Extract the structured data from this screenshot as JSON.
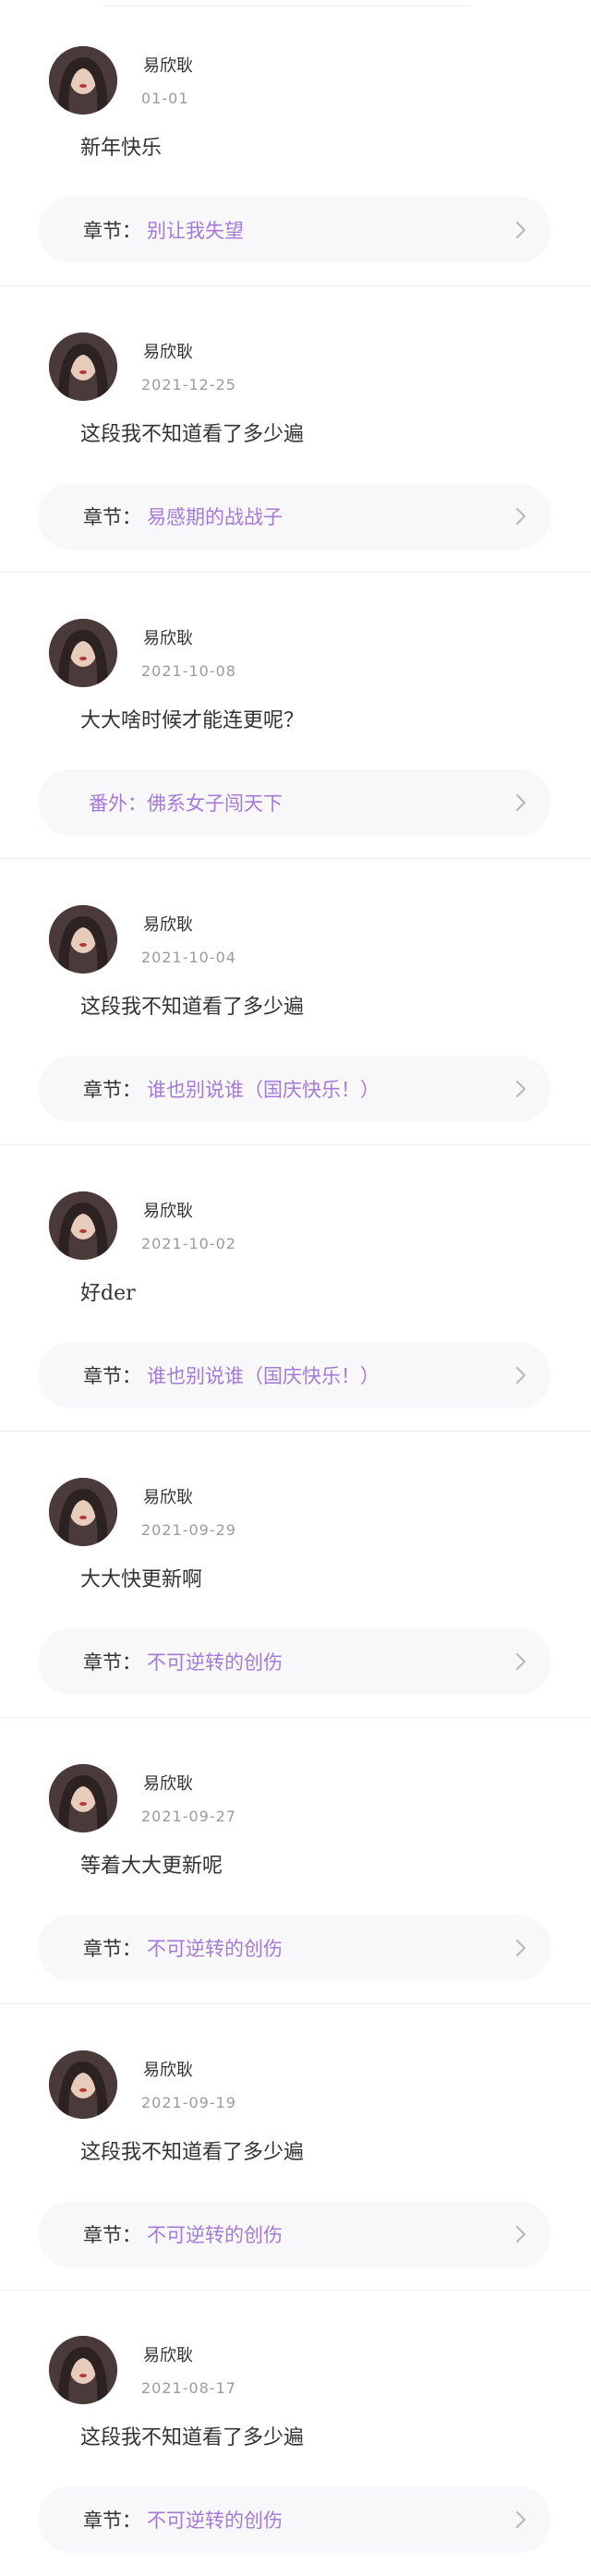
{
  "comments": [
    {
      "user": "易欣耿",
      "date": "01-01",
      "text": "新年快乐",
      "chapter_prefix": "章节：",
      "chapter_title": "别让我失望"
    },
    {
      "user": "易欣耿",
      "date": "2021-12-25",
      "text": "这段我不知道看了多少遍",
      "chapter_prefix": "章节：",
      "chapter_title": "易感期的战战子"
    },
    {
      "user": "易欣耿",
      "date": "2021-10-08",
      "text": "大大啥时候才能连更呢？",
      "chapter_prefix": "",
      "chapter_title": "番外：佛系女子闯天下"
    },
    {
      "user": "易欣耿",
      "date": "2021-10-04",
      "text": "这段我不知道看了多少遍",
      "chapter_prefix": "章节：",
      "chapter_title": "谁也别说谁（国庆快乐！）"
    },
    {
      "user": "易欣耿",
      "date": "2021-10-02",
      "text": "好der",
      "chapter_prefix": "章节：",
      "chapter_title": "谁也别说谁（国庆快乐！）"
    },
    {
      "user": "易欣耿",
      "date": "2021-09-29",
      "text": "大大快更新啊",
      "chapter_prefix": "章节：",
      "chapter_title": "不可逆转的创伤"
    },
    {
      "user": "易欣耿",
      "date": "2021-09-27",
      "text": "等着大大更新呢",
      "chapter_prefix": "章节：",
      "chapter_title": "不可逆转的创伤"
    },
    {
      "user": "易欣耿",
      "date": "2021-09-19",
      "text": "这段我不知道看了多少遍",
      "chapter_prefix": "章节：",
      "chapter_title": "不可逆转的创伤"
    },
    {
      "user": "易欣耿",
      "date": "2021-08-17",
      "text": "这段我不知道看了多少遍",
      "chapter_prefix": "章节：",
      "chapter_title": "不可逆转的创伤"
    }
  ],
  "colors": {
    "accent": "#a57ad6",
    "text": "#333333",
    "muted": "#9a9aa2",
    "card_background": "#f8f8fa"
  },
  "icons": {
    "avatar": "user-avatar",
    "chevron": "chevron-right-icon"
  }
}
